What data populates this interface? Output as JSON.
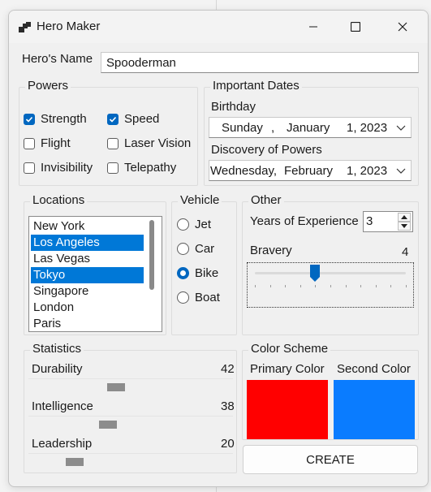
{
  "window": {
    "title": "Hero Maker"
  },
  "hero_name": {
    "label": "Hero's Name",
    "value": "Spooderman"
  },
  "powers": {
    "title": "Powers",
    "items": [
      {
        "label": "Strength",
        "checked": true
      },
      {
        "label": "Speed",
        "checked": true
      },
      {
        "label": "Flight",
        "checked": false
      },
      {
        "label": "Laser Vision",
        "checked": false
      },
      {
        "label": "Invisibility",
        "checked": false
      },
      {
        "label": "Telepathy",
        "checked": false
      }
    ]
  },
  "important_dates": {
    "title": "Important Dates",
    "birthday": {
      "label": "Birthday",
      "weekday": "Sunday",
      "sep": ",",
      "month": "January",
      "day_year": "1, 2023"
    },
    "discovery": {
      "label": "Discovery of Powers",
      "weekday": "Wednesday,",
      "month": "February",
      "day_year": "1, 2023"
    }
  },
  "locations": {
    "title": "Locations",
    "items": [
      {
        "label": "New York",
        "selected": false
      },
      {
        "label": "Los Angeles",
        "selected": true
      },
      {
        "label": "Las Vegas",
        "selected": false
      },
      {
        "label": "Tokyo",
        "selected": true
      },
      {
        "label": "Singapore",
        "selected": false
      },
      {
        "label": "London",
        "selected": false
      },
      {
        "label": "Paris",
        "selected": false
      }
    ]
  },
  "vehicle": {
    "title": "Vehicle",
    "options": [
      {
        "label": "Jet",
        "checked": false
      },
      {
        "label": "Car",
        "checked": false
      },
      {
        "label": "Bike",
        "checked": true
      },
      {
        "label": "Boat",
        "checked": false
      }
    ]
  },
  "other": {
    "title": "Other",
    "years_label": "Years of Experience",
    "years_value": "3",
    "bravery_label": "Bravery",
    "bravery_value": "4",
    "bravery_max": 10
  },
  "statistics": {
    "title": "Statistics",
    "items": [
      {
        "label": "Durability",
        "value": "42",
        "fraction": 0.42
      },
      {
        "label": "Intelligence",
        "value": "38",
        "fraction": 0.38
      },
      {
        "label": "Leadership",
        "value": "20",
        "fraction": 0.2
      }
    ]
  },
  "color_scheme": {
    "title": "Color Scheme",
    "primary_label": "Primary Color",
    "primary_color": "#ff0000",
    "secondary_label": "Second Color",
    "secondary_color": "#0a7cff"
  },
  "create_button": {
    "label": "CREATE"
  },
  "colors": {
    "accent": "#0067c0",
    "selection": "#0078d7"
  }
}
